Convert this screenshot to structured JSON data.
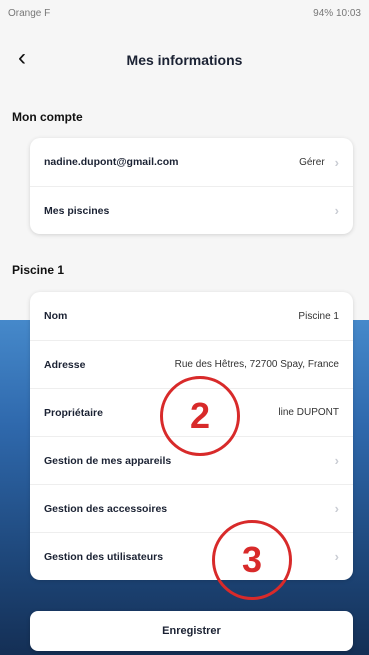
{
  "status": {
    "carrier": "Orange F",
    "right": "94% 10:03"
  },
  "header": {
    "back_icon": "chevron-left",
    "title": "Mes informations"
  },
  "account": {
    "section_title": "Mon compte",
    "email": "nadine.dupont@gmail.com",
    "manage_label": "Gérer",
    "pools_label": "Mes piscines"
  },
  "pool": {
    "section_title": "Piscine 1",
    "rows": [
      {
        "label": "Nom",
        "value": "Piscine 1"
      },
      {
        "label": "Adresse",
        "value": "Rue des Hêtres, 72700 Spay, France"
      },
      {
        "label": "Propriétaire",
        "value": "line DUPONT"
      },
      {
        "label": "Gestion de mes appareils",
        "value": ""
      },
      {
        "label": "Gestion des accessoires",
        "value": ""
      },
      {
        "label": "Gestion des utilisateurs",
        "value": ""
      }
    ]
  },
  "annotations": {
    "a2": "2",
    "a3": "3"
  },
  "save_button": "Enregistrer",
  "colors": {
    "annotation": "#d82a2a",
    "water_top": "#4a8fd0",
    "water_bottom": "#142f55"
  }
}
